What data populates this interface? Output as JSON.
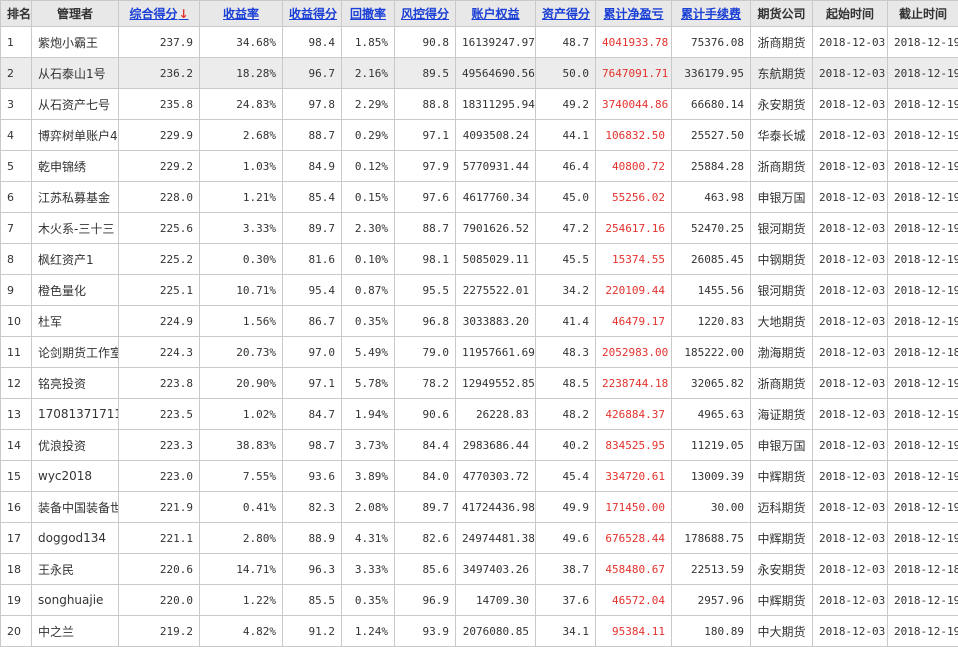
{
  "headers": {
    "rank": "排名",
    "manager": "管理者",
    "composite": "综合得分",
    "composite_arrow": "↓",
    "return_rate": "收益率",
    "return_score": "收益得分",
    "drawdown": "回撤率",
    "risk_score": "风控得分",
    "equity": "账户权益",
    "asset_score": "资产得分",
    "net_profit": "累计净盈亏",
    "fees": "累计手续费",
    "company": "期货公司",
    "start": "起始时间",
    "end": "截止时间"
  },
  "colors": {
    "profit": "#e3322d",
    "link": "#1a3fd6",
    "sort_arrow": "#e53333",
    "header_bg": "#e8e8e8"
  },
  "rows": [
    {
      "rank": "1",
      "manager": "紫炮小霸王",
      "composite": "237.9",
      "return_rate": "34.68%",
      "return_score": "98.4",
      "drawdown": "1.85%",
      "risk_score": "90.8",
      "equity": "16139247.97",
      "asset_score": "48.7",
      "net_profit": "4041933.78",
      "fees": "75376.08",
      "company": "浙商期货",
      "start": "2018-12-03",
      "end": "2018-12-19"
    },
    {
      "rank": "2",
      "manager": "从石泰山1号",
      "composite": "236.2",
      "return_rate": "18.28%",
      "return_score": "96.7",
      "drawdown": "2.16%",
      "risk_score": "89.5",
      "equity": "49564690.56",
      "asset_score": "50.0",
      "net_profit": "7647091.71",
      "fees": "336179.95",
      "company": "东航期货",
      "start": "2018-12-03",
      "end": "2018-12-19"
    },
    {
      "rank": "3",
      "manager": "从石资产七号",
      "composite": "235.8",
      "return_rate": "24.83%",
      "return_score": "97.8",
      "drawdown": "2.29%",
      "risk_score": "88.8",
      "equity": "18311295.94",
      "asset_score": "49.2",
      "net_profit": "3740044.86",
      "fees": "66680.14",
      "company": "永安期货",
      "start": "2018-12-03",
      "end": "2018-12-19"
    },
    {
      "rank": "4",
      "manager": "博弈树单账户4·",
      "composite": "229.9",
      "return_rate": "2.68%",
      "return_score": "88.7",
      "drawdown": "0.29%",
      "risk_score": "97.1",
      "equity": "4093508.24",
      "asset_score": "44.1",
      "net_profit": "106832.50",
      "fees": "25527.50",
      "company": "华泰长城",
      "start": "2018-12-03",
      "end": "2018-12-19"
    },
    {
      "rank": "5",
      "manager": "乾申锦绣",
      "composite": "229.2",
      "return_rate": "1.03%",
      "return_score": "84.9",
      "drawdown": "0.12%",
      "risk_score": "97.9",
      "equity": "5770931.44",
      "asset_score": "46.4",
      "net_profit": "40800.72",
      "fees": "25884.28",
      "company": "浙商期货",
      "start": "2018-12-03",
      "end": "2018-12-19"
    },
    {
      "rank": "6",
      "manager": "江苏私募基金",
      "composite": "228.0",
      "return_rate": "1.21%",
      "return_score": "85.4",
      "drawdown": "0.15%",
      "risk_score": "97.6",
      "equity": "4617760.34",
      "asset_score": "45.0",
      "net_profit": "55256.02",
      "fees": "463.98",
      "company": "申银万国",
      "start": "2018-12-03",
      "end": "2018-12-19"
    },
    {
      "rank": "7",
      "manager": "木火系-三十三",
      "composite": "225.6",
      "return_rate": "3.33%",
      "return_score": "89.7",
      "drawdown": "2.30%",
      "risk_score": "88.7",
      "equity": "7901626.52",
      "asset_score": "47.2",
      "net_profit": "254617.16",
      "fees": "52470.25",
      "company": "银河期货",
      "start": "2018-12-03",
      "end": "2018-12-19"
    },
    {
      "rank": "8",
      "manager": "枫红资产1",
      "composite": "225.2",
      "return_rate": "0.30%",
      "return_score": "81.6",
      "drawdown": "0.10%",
      "risk_score": "98.1",
      "equity": "5085029.11",
      "asset_score": "45.5",
      "net_profit": "15374.55",
      "fees": "26085.45",
      "company": "中钢期货",
      "start": "2018-12-03",
      "end": "2018-12-19"
    },
    {
      "rank": "9",
      "manager": "橙色量化",
      "composite": "225.1",
      "return_rate": "10.71%",
      "return_score": "95.4",
      "drawdown": "0.87%",
      "risk_score": "95.5",
      "equity": "2275522.01",
      "asset_score": "34.2",
      "net_profit": "220109.44",
      "fees": "1455.56",
      "company": "银河期货",
      "start": "2018-12-03",
      "end": "2018-12-19"
    },
    {
      "rank": "10",
      "manager": "杜军",
      "composite": "224.9",
      "return_rate": "1.56%",
      "return_score": "86.7",
      "drawdown": "0.35%",
      "risk_score": "96.8",
      "equity": "3033883.20",
      "asset_score": "41.4",
      "net_profit": "46479.17",
      "fees": "1220.83",
      "company": "大地期货",
      "start": "2018-12-03",
      "end": "2018-12-19"
    },
    {
      "rank": "11",
      "manager": "论剑期货工作室",
      "composite": "224.3",
      "return_rate": "20.73%",
      "return_score": "97.0",
      "drawdown": "5.49%",
      "risk_score": "79.0",
      "equity": "11957661.69",
      "asset_score": "48.3",
      "net_profit": "2052983.00",
      "fees": "185222.00",
      "company": "渤海期货",
      "start": "2018-12-03",
      "end": "2018-12-18"
    },
    {
      "rank": "12",
      "manager": "铭亮投资",
      "composite": "223.8",
      "return_rate": "20.90%",
      "return_score": "97.1",
      "drawdown": "5.78%",
      "risk_score": "78.2",
      "equity": "12949552.85",
      "asset_score": "48.5",
      "net_profit": "2238744.18",
      "fees": "32065.82",
      "company": "浙商期货",
      "start": "2018-12-03",
      "end": "2018-12-19"
    },
    {
      "rank": "13",
      "manager": "17081371711",
      "composite": "223.5",
      "return_rate": "1.02%",
      "return_score": "84.7",
      "drawdown": "1.94%",
      "risk_score": "90.6",
      "equity": "26228.83",
      "asset_score": "48.2",
      "net_profit": "426884.37",
      "fees": "4965.63",
      "company": "海证期货",
      "start": "2018-12-03",
      "end": "2018-12-19"
    },
    {
      "rank": "14",
      "manager": "优浪投资",
      "composite": "223.3",
      "return_rate": "38.83%",
      "return_score": "98.7",
      "drawdown": "3.73%",
      "risk_score": "84.4",
      "equity": "2983686.44",
      "asset_score": "40.2",
      "net_profit": "834525.95",
      "fees": "11219.05",
      "company": "申银万国",
      "start": "2018-12-03",
      "end": "2018-12-19"
    },
    {
      "rank": "15",
      "manager": "wyc2018",
      "composite": "223.0",
      "return_rate": "7.55%",
      "return_score": "93.6",
      "drawdown": "3.89%",
      "risk_score": "84.0",
      "equity": "4770303.72",
      "asset_score": "45.4",
      "net_profit": "334720.61",
      "fees": "13009.39",
      "company": "中辉期货",
      "start": "2018-12-03",
      "end": "2018-12-19"
    },
    {
      "rank": "16",
      "manager": "装备中国装备世",
      "composite": "221.9",
      "return_rate": "0.41%",
      "return_score": "82.3",
      "drawdown": "2.08%",
      "risk_score": "89.7",
      "equity": "41724436.98",
      "asset_score": "49.9",
      "net_profit": "171450.00",
      "fees": "30.00",
      "company": "迈科期货",
      "start": "2018-12-03",
      "end": "2018-12-19"
    },
    {
      "rank": "17",
      "manager": "doggod134",
      "composite": "221.1",
      "return_rate": "2.80%",
      "return_score": "88.9",
      "drawdown": "4.31%",
      "risk_score": "82.6",
      "equity": "24974481.38",
      "asset_score": "49.6",
      "net_profit": "676528.44",
      "fees": "178688.75",
      "company": "中辉期货",
      "start": "2018-12-03",
      "end": "2018-12-19"
    },
    {
      "rank": "18",
      "manager": "王永民",
      "composite": "220.6",
      "return_rate": "14.71%",
      "return_score": "96.3",
      "drawdown": "3.33%",
      "risk_score": "85.6",
      "equity": "3497403.26",
      "asset_score": "38.7",
      "net_profit": "458480.67",
      "fees": "22513.59",
      "company": "永安期货",
      "start": "2018-12-03",
      "end": "2018-12-18"
    },
    {
      "rank": "19",
      "manager": "songhuajie",
      "composite": "220.0",
      "return_rate": "1.22%",
      "return_score": "85.5",
      "drawdown": "0.35%",
      "risk_score": "96.9",
      "equity": "14709.30",
      "asset_score": "37.6",
      "net_profit": "46572.04",
      "fees": "2957.96",
      "company": "中辉期货",
      "start": "2018-12-03",
      "end": "2018-12-19"
    },
    {
      "rank": "20",
      "manager": "中之兰",
      "composite": "219.2",
      "return_rate": "4.82%",
      "return_score": "91.2",
      "drawdown": "1.24%",
      "risk_score": "93.9",
      "equity": "2076080.85",
      "asset_score": "34.1",
      "net_profit": "95384.11",
      "fees": "180.89",
      "company": "中大期货",
      "start": "2018-12-03",
      "end": "2018-12-19"
    }
  ]
}
